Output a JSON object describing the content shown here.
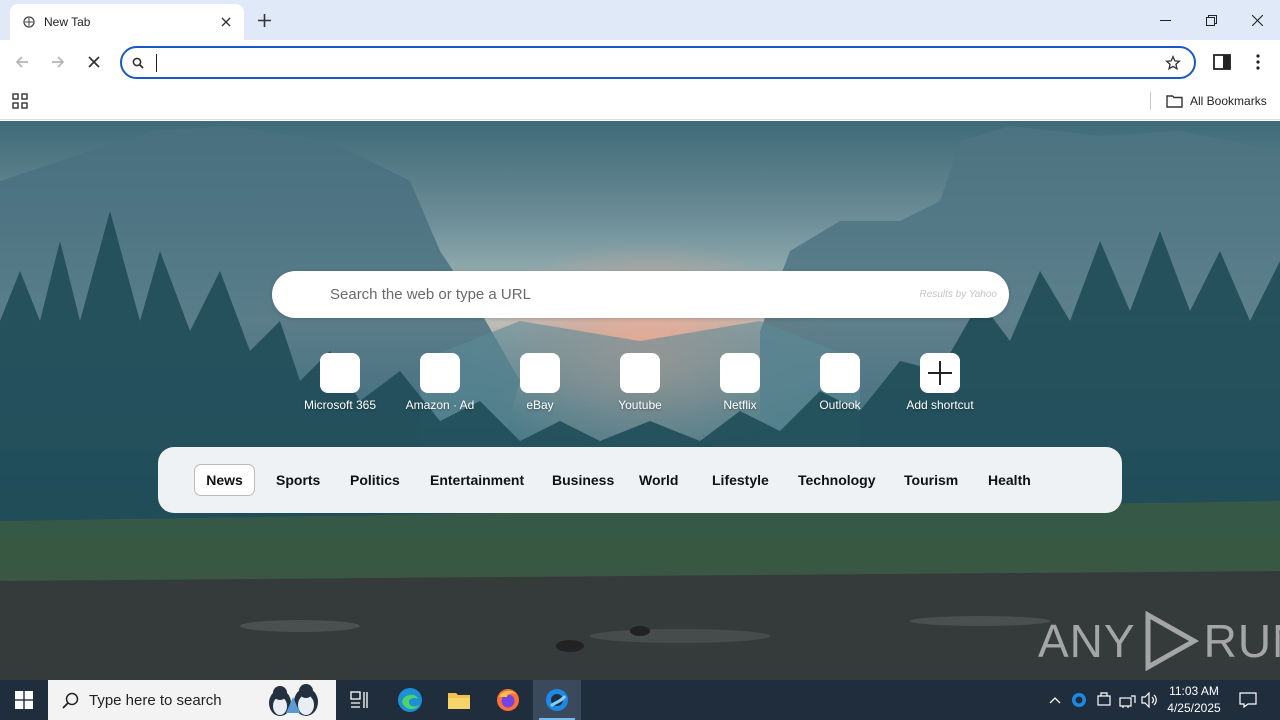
{
  "browser": {
    "tab": {
      "title": "New Tab"
    },
    "address_bar": {
      "value": ""
    },
    "bookmarks": {
      "all_bookmarks_label": "All Bookmarks"
    }
  },
  "newtab": {
    "search": {
      "placeholder": "Search the web or type a URL",
      "powered_by": "Results by Yahoo"
    },
    "shortcuts": [
      {
        "label": "Microsoft 365"
      },
      {
        "label": "Amazon · Ad"
      },
      {
        "label": "eBay"
      },
      {
        "label": "Youtube"
      },
      {
        "label": "Netflix"
      },
      {
        "label": "Outlook"
      },
      {
        "label": "Add shortcut"
      }
    ],
    "news_tabs": [
      {
        "label": "News",
        "active": true
      },
      {
        "label": "Sports"
      },
      {
        "label": "Politics"
      },
      {
        "label": "Entertainment"
      },
      {
        "label": "Business"
      },
      {
        "label": "World"
      },
      {
        "label": "Lifestyle"
      },
      {
        "label": "Technology"
      },
      {
        "label": "Tourism"
      },
      {
        "label": "Health"
      }
    ],
    "watermark": {
      "left": "ANY",
      "right": "RUN"
    }
  },
  "taskbar": {
    "search_placeholder": "Type here to search",
    "clock": {
      "time": "11:03 AM",
      "date": "4/25/2025"
    }
  },
  "colors": {
    "omnibox_border": "#1a57c8",
    "tabstrip_bg": "#dfe9f7",
    "taskbar_bg": "#1f2d3d",
    "newsbar_bg": "#eef2f5"
  }
}
